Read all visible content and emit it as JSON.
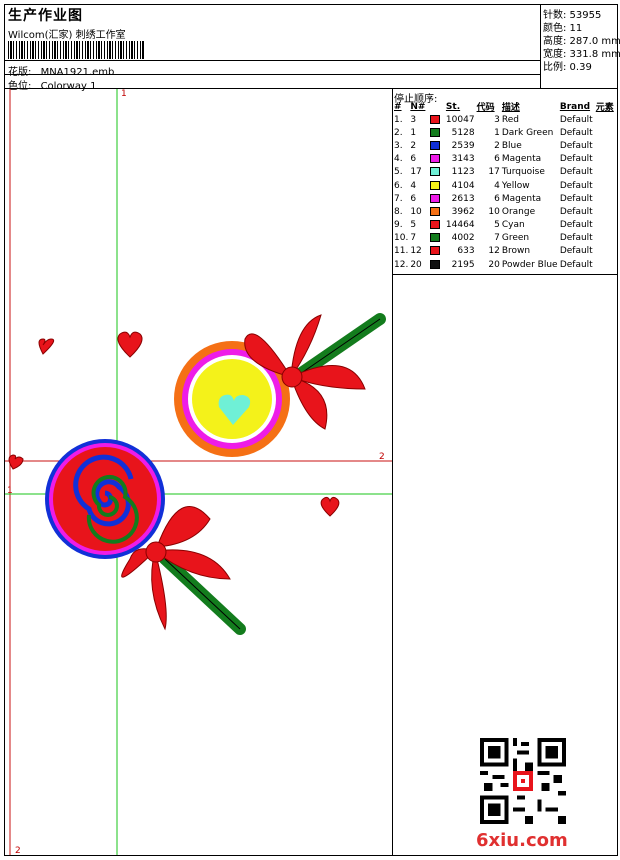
{
  "header": {
    "title": "生产作业图",
    "company": "Wilcom(汇家) 刺绣工作室",
    "design_label": "花版:",
    "design_value": "MNA1921.emb",
    "colorway_label": "色位:",
    "colorway_value": "Colorway 1"
  },
  "stats": {
    "stitches": "针数: 53955",
    "colors": "颜色: 11",
    "height": "高度: 287.0 mm",
    "width": "宽度: 331.8 mm",
    "scale": "比例: 0.39"
  },
  "sequence": {
    "title": "停止顺序:",
    "headers": [
      "#",
      "N#",
      "",
      "St.",
      "代码",
      "描述",
      "Brand",
      "元素"
    ],
    "rows": [
      {
        "idx": "1.",
        "n": "3",
        "color": "#e8141b",
        "st": "10047",
        "code": "3",
        "desc": "Red",
        "brand": "Default"
      },
      {
        "idx": "2.",
        "n": "1",
        "color": "#137c1d",
        "st": "5128",
        "code": "1",
        "desc": "Dark Green",
        "brand": "Default"
      },
      {
        "idx": "3.",
        "n": "2",
        "color": "#1130d8",
        "st": "2539",
        "code": "2",
        "desc": "Blue",
        "brand": "Default"
      },
      {
        "idx": "4.",
        "n": "6",
        "color": "#ee1ce8",
        "st": "3143",
        "code": "6",
        "desc": "Magenta",
        "brand": "Default"
      },
      {
        "idx": "5.",
        "n": "17",
        "color": "#6ff0d6",
        "st": "1123",
        "code": "17",
        "desc": "Turquoise",
        "brand": "Default"
      },
      {
        "idx": "6.",
        "n": "4",
        "color": "#f4f21a",
        "st": "4104",
        "code": "4",
        "desc": "Yellow",
        "brand": "Default"
      },
      {
        "idx": "7.",
        "n": "6",
        "color": "#ee1ce8",
        "st": "2613",
        "code": "6",
        "desc": "Magenta",
        "brand": "Default"
      },
      {
        "idx": "8.",
        "n": "10",
        "color": "#f57015",
        "st": "3962",
        "code": "10",
        "desc": "Orange",
        "brand": "Default"
      },
      {
        "idx": "9.",
        "n": "5",
        "color": "#e8141b",
        "st": "14464",
        "code": "5",
        "desc": "Cyan",
        "brand": "Default"
      },
      {
        "idx": "10.",
        "n": "7",
        "color": "#137c1d",
        "st": "4002",
        "code": "7",
        "desc": "Green",
        "brand": "Default"
      },
      {
        "idx": "11.",
        "n": "12",
        "color": "#e8141b",
        "st": "633",
        "code": "12",
        "desc": "Brown",
        "brand": "Default"
      },
      {
        "idx": "12.",
        "n": "20",
        "color": "#111111",
        "st": "2195",
        "code": "20",
        "desc": "Powder Blue",
        "brand": "Default"
      }
    ]
  },
  "guides": {
    "top_label": "1",
    "right_label": "2",
    "left_label": "1",
    "bottom_label": "2"
  },
  "footer": {
    "site_logo": "6xiu.com"
  },
  "colors": {
    "guide_green": "#19c419",
    "guide_red": "#c81010"
  }
}
